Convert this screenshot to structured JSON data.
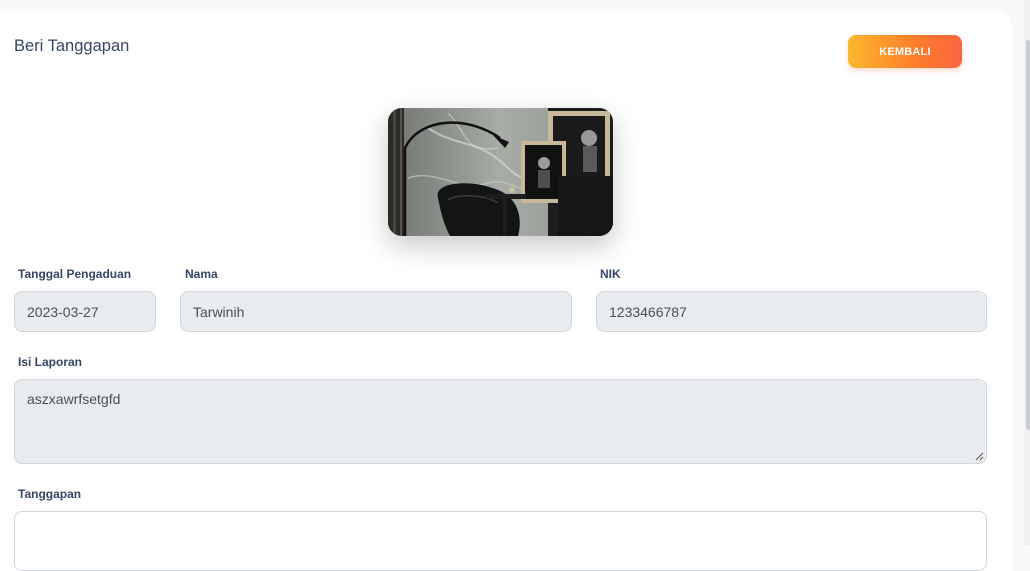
{
  "header": {
    "title": "Beri Tanggapan",
    "back_button": "KEMBALI"
  },
  "form": {
    "tanggal": {
      "label": "Tanggal Pengaduan",
      "value": "2023-03-27"
    },
    "nama": {
      "label": "Nama",
      "value": "Tarwinih"
    },
    "nik": {
      "label": "NIK",
      "value": "1233466787"
    },
    "isi_laporan": {
      "label": "Isi Laporan",
      "value": "aszxawrfsetgfd"
    },
    "tanggapan": {
      "label": "Tanggapan",
      "value": ""
    }
  },
  "colors": {
    "button_gradient_start": "#fbb72e",
    "button_gradient_end": "#fb6340",
    "readonly_field_bg": "#e9ecef",
    "text_primary": "#344767"
  }
}
